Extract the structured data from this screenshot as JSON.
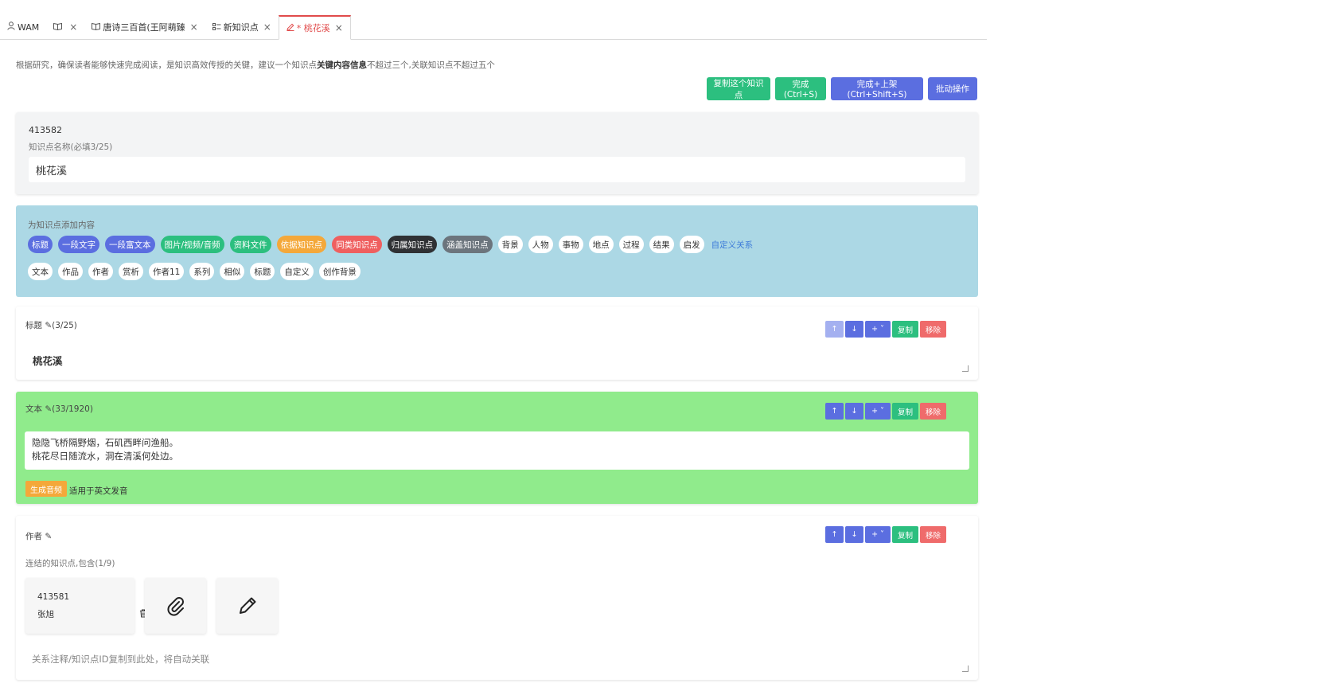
{
  "tabs": [
    {
      "icon": "user-icon",
      "label": "WAM",
      "closable": false
    },
    {
      "icon": "book-icon",
      "label": "",
      "closable": true
    },
    {
      "icon": "book-icon",
      "label": "唐诗三百首(王阿萌臻",
      "closable": true
    },
    {
      "icon": "list-icon",
      "label": "新知识点",
      "closable": true
    },
    {
      "icon": "edit-icon",
      "label": "* 桃花溪",
      "closable": true,
      "active": true
    }
  ],
  "notice": {
    "prefix": "根据研究，确保读者能够快速完成阅读，是知识高效传授的关键，建议一个知识点",
    "bold": "关键内容信息",
    "suffix": "不超过三个,关联知识点不超过五个"
  },
  "actions": {
    "copy_kp": "复制这个知识点",
    "complete": "完成(Ctrl+S)",
    "complete_publish": "完成+上架(Ctrl+Shift+S)",
    "batch": "批动操作"
  },
  "knowledge": {
    "id": "413582",
    "name_label": "知识点名称(必填3/25)",
    "name_value": "桃花溪"
  },
  "add_panel": {
    "header": "为知识点添加内容",
    "row1": [
      {
        "label": "标题",
        "color": "#5b6ee0"
      },
      {
        "label": "一段文字",
        "color": "#5b6ee0"
      },
      {
        "label": "一段富文本",
        "color": "#5b6ee0"
      },
      {
        "label": "图片/视频/音频",
        "color": "#2cbf7f"
      },
      {
        "label": "资料文件",
        "color": "#2cbf7f"
      },
      {
        "label": "依据知识点",
        "color": "#f4a83a"
      },
      {
        "label": "同类知识点",
        "color": "#ef5f5f"
      },
      {
        "label": "归属知识点",
        "color": "#2f3134"
      },
      {
        "label": "涵盖知识点",
        "color": "#6c757d"
      },
      {
        "label": "背景",
        "color": "white"
      },
      {
        "label": "人物",
        "color": "white"
      },
      {
        "label": "事物",
        "color": "white"
      },
      {
        "label": "地点",
        "color": "white"
      },
      {
        "label": "过程",
        "color": "white"
      },
      {
        "label": "结果",
        "color": "white"
      },
      {
        "label": "启发",
        "color": "white"
      },
      {
        "label": "自定义关系",
        "color": "link"
      }
    ],
    "row2": [
      "文本",
      "作品",
      "作者",
      "赏析",
      "作者11",
      "系列",
      "相似",
      "标题",
      "自定义",
      "创作背景"
    ]
  },
  "section_buttons": {
    "up": "↑",
    "down": "↓",
    "add": "+ ˅",
    "copy": "复制",
    "remove": "移除"
  },
  "title_section": {
    "label": "标题 ✎(3/25)",
    "value": "桃花溪"
  },
  "text_section": {
    "label": "文本 ✎(33/1920)",
    "lines": [
      "隐隐飞桥隔野烟，石矶西畔问渔船。",
      "桃花尽日随流水，洞在清溪何处边。"
    ],
    "generate_audio": "生成音频",
    "audio_note": "适用于英文发音"
  },
  "author_section": {
    "label": "作者 ✎",
    "linked_label": "连结的知识点,包含(1/9)",
    "linked": [
      {
        "id": "413581",
        "name": "张旭"
      }
    ],
    "relation_placeholder": "关系注释/知识点ID复制到此处，将自动关联"
  }
}
